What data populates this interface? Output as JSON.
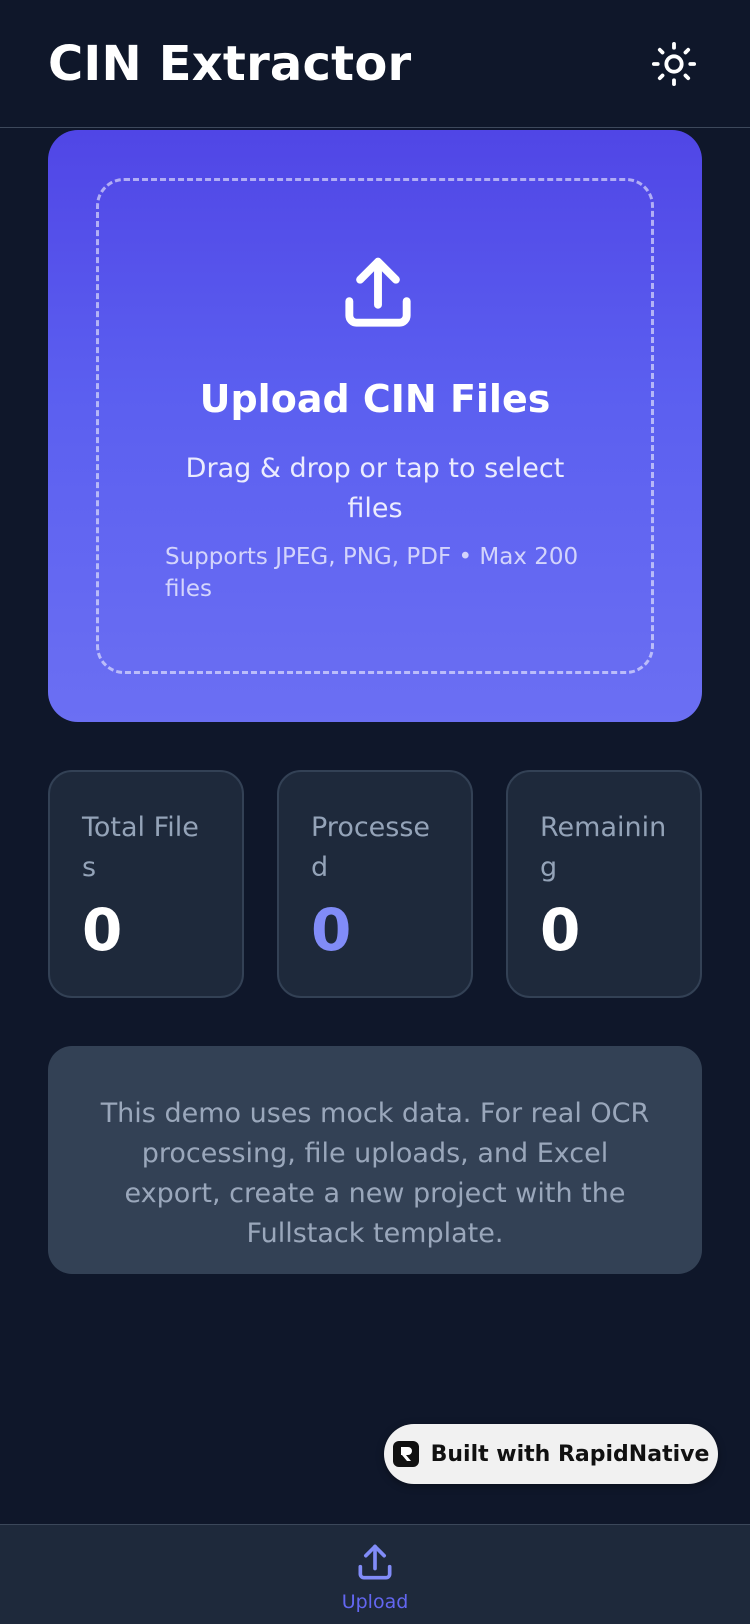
{
  "header": {
    "title": "CIN Extractor",
    "theme_icon": "sun-icon"
  },
  "upload": {
    "icon": "upload-icon",
    "title": "Upload CIN Files",
    "subtitle": "Drag & drop or tap to select files",
    "note": "Supports JPEG, PNG, PDF • Max 200 files"
  },
  "stats": {
    "total_files": {
      "label": "Total Files",
      "value": "0"
    },
    "processed": {
      "label": "Processed",
      "value": "0"
    },
    "remaining": {
      "label": "Remaining",
      "value": "0"
    }
  },
  "info": {
    "text": "This demo uses mock data. For real OCR processing, file uploads, and Excel export, create a new project with the Fullstack template."
  },
  "badge": {
    "label": "Built with RapidNative",
    "icon": "rapidnative-logo-icon"
  },
  "bottom_nav": {
    "items": [
      {
        "label": "Upload",
        "icon": "upload-icon",
        "active": true
      }
    ]
  },
  "colors": {
    "background": "#0f172a",
    "card_gradient_top": "#5046e6",
    "card_gradient_bottom": "#6b6ff3",
    "accent": "#818cf8",
    "panel": "#1e293b"
  }
}
